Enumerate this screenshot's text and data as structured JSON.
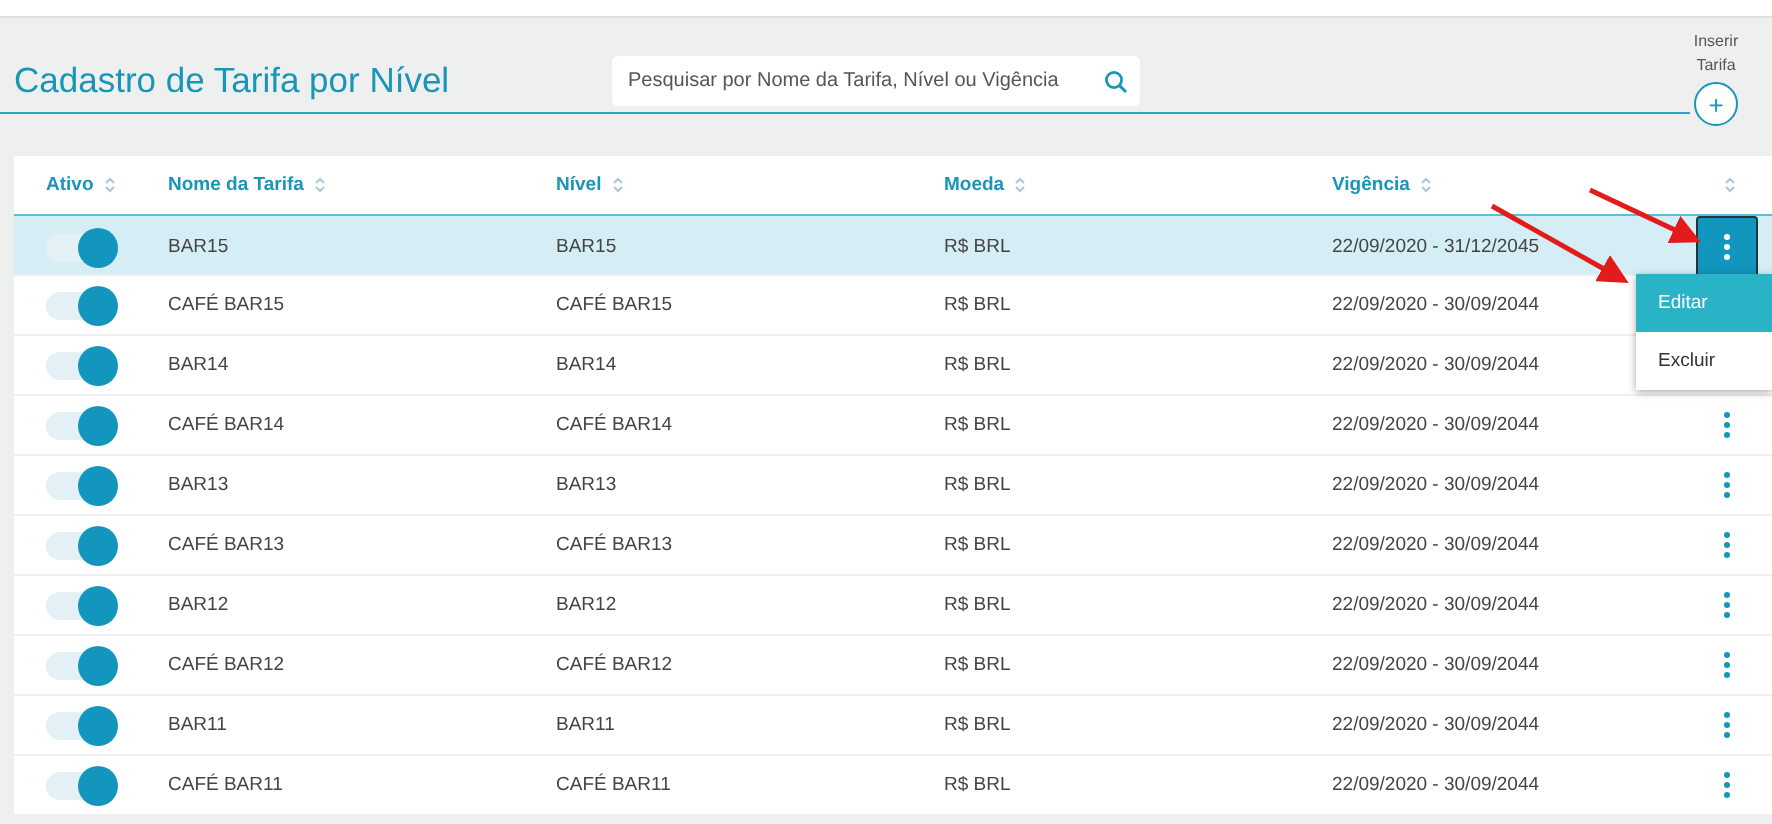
{
  "page_title": "Cadastro de Tarifa por Nível",
  "search": {
    "placeholder": "Pesquisar por Nome da Tarifa, Nível ou Vigência"
  },
  "insert_button": {
    "label_lines": [
      "Inserir",
      "Tarifa"
    ],
    "icon": "+"
  },
  "table": {
    "columns": [
      "Ativo",
      "Nome da Tarifa",
      "Nível",
      "Moeda",
      "Vigência"
    ],
    "rows": [
      {
        "active": true,
        "name": "BAR15",
        "level": "BAR15",
        "currency": "R$ BRL",
        "validity": "22/09/2020 - 31/12/2045",
        "selected": true
      },
      {
        "active": true,
        "name": "CAFÉ BAR15",
        "level": "CAFÉ BAR15",
        "currency": "R$ BRL",
        "validity": "22/09/2020 - 30/09/2044",
        "selected": false
      },
      {
        "active": true,
        "name": "BAR14",
        "level": "BAR14",
        "currency": "R$ BRL",
        "validity": "22/09/2020 - 30/09/2044",
        "selected": false
      },
      {
        "active": true,
        "name": "CAFÉ BAR14",
        "level": "CAFÉ BAR14",
        "currency": "R$ BRL",
        "validity": "22/09/2020 - 30/09/2044",
        "selected": false
      },
      {
        "active": true,
        "name": "BAR13",
        "level": "BAR13",
        "currency": "R$ BRL",
        "validity": "22/09/2020 - 30/09/2044",
        "selected": false
      },
      {
        "active": true,
        "name": "CAFÉ BAR13",
        "level": "CAFÉ BAR13",
        "currency": "R$ BRL",
        "validity": "22/09/2020 - 30/09/2044",
        "selected": false
      },
      {
        "active": true,
        "name": "BAR12",
        "level": "BAR12",
        "currency": "R$ BRL",
        "validity": "22/09/2020 - 30/09/2044",
        "selected": false
      },
      {
        "active": true,
        "name": "CAFÉ BAR12",
        "level": "CAFÉ BAR12",
        "currency": "R$ BRL",
        "validity": "22/09/2020 - 30/09/2044",
        "selected": false
      },
      {
        "active": true,
        "name": "BAR11",
        "level": "BAR11",
        "currency": "R$ BRL",
        "validity": "22/09/2020 - 30/09/2044",
        "selected": false
      },
      {
        "active": true,
        "name": "CAFÉ BAR11",
        "level": "CAFÉ BAR11",
        "currency": "R$ BRL",
        "validity": "22/09/2020 - 30/09/2044",
        "selected": false
      }
    ]
  },
  "row_menu": {
    "items": [
      {
        "label": "Editar",
        "selected": true
      },
      {
        "label": "Excluir",
        "selected": false
      }
    ]
  }
}
